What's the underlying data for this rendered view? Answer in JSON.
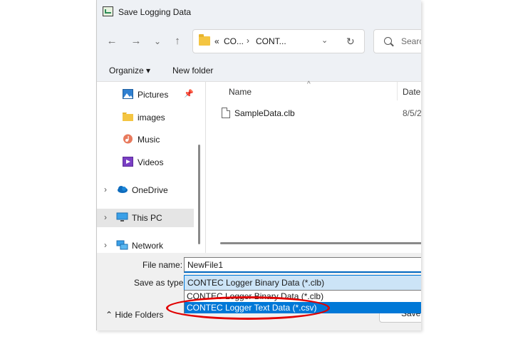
{
  "window": {
    "title": "Save Logging Data"
  },
  "navigation": {
    "back_glyph": "←",
    "forward_glyph": "→",
    "recent_glyph": "⌄",
    "up_glyph": "↑"
  },
  "address_bar": {
    "overflow": "«",
    "crumbs": [
      "CO...",
      "CONT..."
    ],
    "separator": "›",
    "dropdown_glyph": "⌄",
    "refresh_glyph": "↻"
  },
  "search": {
    "placeholder": "Searc"
  },
  "command_bar": {
    "organize": "Organize ▾",
    "new_folder": "New folder"
  },
  "sidebar": {
    "expander_glyph": "›",
    "pin_glyph": "📌",
    "items": [
      {
        "label": "Pictures",
        "icon": "pictures-icon"
      },
      {
        "label": "images",
        "icon": "folder-icon"
      },
      {
        "label": "Music",
        "icon": "music-icon"
      },
      {
        "label": "Videos",
        "icon": "videos-icon"
      },
      {
        "label": "OneDrive",
        "icon": "cloud-icon"
      },
      {
        "label": "This PC",
        "icon": "computer-icon"
      },
      {
        "label": "Network",
        "icon": "network-icon"
      }
    ]
  },
  "file_list": {
    "columns": {
      "name": "Name",
      "date": "Date"
    },
    "sort_glyph": "^",
    "files": [
      {
        "name": "SampleData.clb",
        "date": "8/5/2"
      }
    ]
  },
  "form": {
    "file_name_label": "File name:",
    "file_name_value": "NewFile1",
    "save_as_type_label": "Save as type:",
    "save_as_type_value": "CONTEC Logger Binary Data (*.clb)",
    "type_options": [
      "CONTEC Logger Binary Data (*.clb)",
      "CONTEC Logger Text Data (*.csv)"
    ]
  },
  "footer": {
    "hide_folders": "⌃ Hide Folders",
    "save": "Save"
  },
  "colors": {
    "selection": "#0078d7",
    "annotation": "#e00000"
  }
}
